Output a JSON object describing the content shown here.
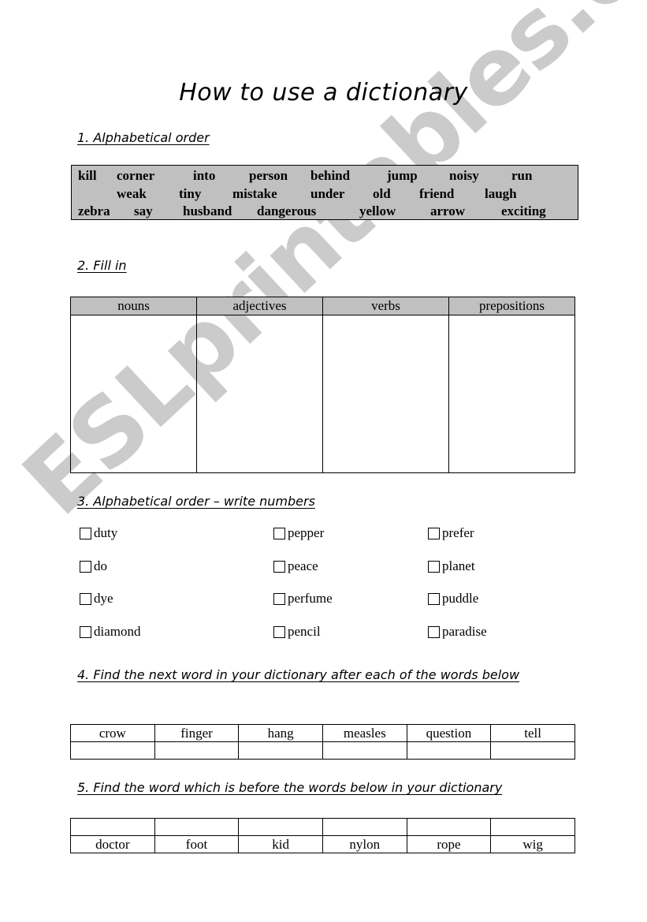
{
  "title": "How to use a dictionary",
  "section1": {
    "heading": "1. Alphabetical order",
    "words": [
      [
        "kill",
        "corner",
        "into",
        "person",
        "behind",
        "jump",
        "noisy",
        "run"
      ],
      [
        "weak",
        "tiny",
        "mistake",
        "under",
        "old",
        "friend",
        "laugh"
      ],
      [
        "zebra",
        "say",
        "husband",
        "dangerous",
        "yellow",
        "arrow",
        "exciting"
      ]
    ]
  },
  "section2": {
    "heading": "2. Fill in",
    "columns": [
      "nouns",
      "adjectives",
      "verbs",
      "prepositions"
    ]
  },
  "section3": {
    "heading": "3. Alphabetical order – write numbers",
    "columns": [
      [
        "duty",
        "do",
        "dye",
        "diamond"
      ],
      [
        "pepper",
        "peace",
        "perfume",
        "pencil"
      ],
      [
        "prefer",
        "planet",
        "puddle",
        "paradise"
      ]
    ]
  },
  "section4": {
    "heading": "4. Find the next word in your dictionary after each of the words below",
    "words": [
      "crow",
      "finger",
      "hang",
      "measles",
      "question",
      "tell"
    ]
  },
  "section5": {
    "heading": "5. Find the word which is before the words below in your dictionary",
    "words": [
      "doctor",
      "foot",
      "kid",
      "nylon",
      "rope",
      "wig"
    ]
  },
  "watermark": "ESLprintables.com"
}
